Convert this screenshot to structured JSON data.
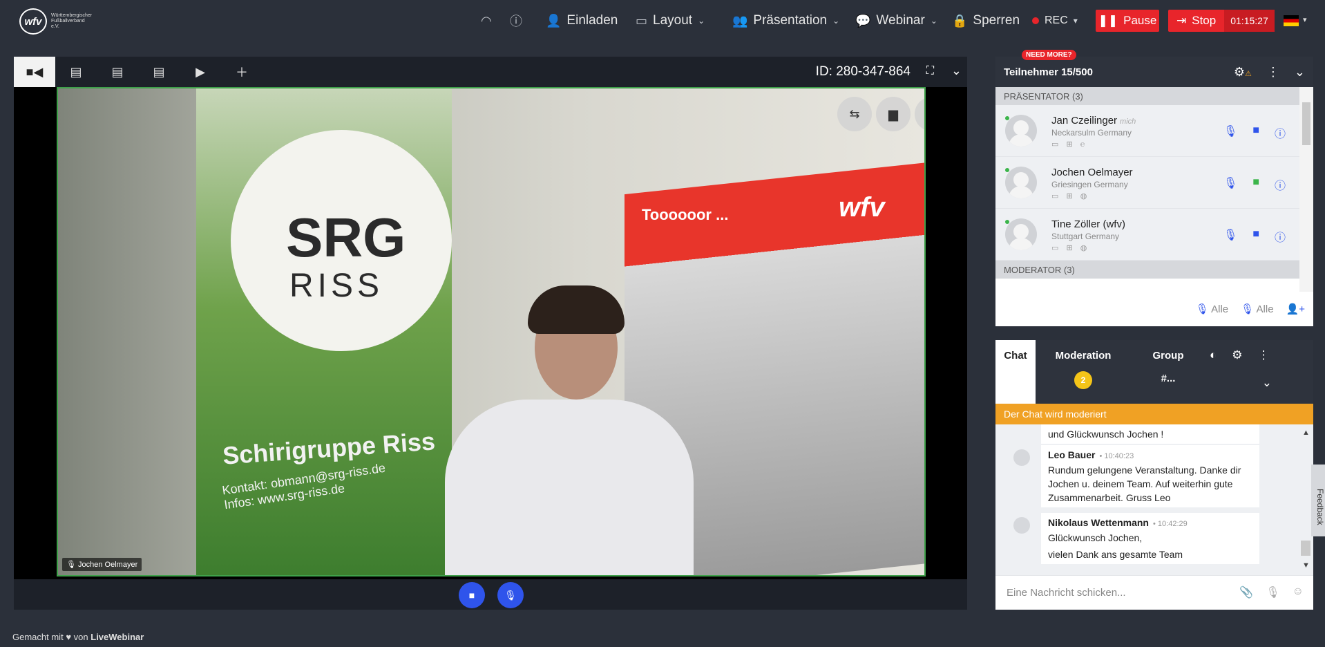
{
  "header": {
    "logo_mark": "wfv",
    "logo_text": "Württembergischer Fußballverband e.V.",
    "invite": "Einladen",
    "layout": "Layout",
    "presentation": "Präsentation",
    "webinar": "Webinar",
    "lock": "Sperren",
    "rec": "REC",
    "pause": "Pause",
    "stop": "Stop",
    "timer": "01:15:27"
  },
  "stage": {
    "meeting_id": "ID: 280-347-864",
    "video_label": "Jochen Oelmayer",
    "scene": {
      "srg": "SRG",
      "riss": "RISS",
      "schiri": "Schirigruppe Riss",
      "contact": "Kontakt: obmann@srg-riss.de",
      "infos": "Infos: www.srg-riss.de",
      "tor": "Toooooor ...",
      "wfv": "wfv"
    }
  },
  "participants": {
    "need_more": "NEED MORE?",
    "title": "Teilnehmer 15/500",
    "presenter_section": "PRÄSENTATOR",
    "presenter_count": "(3)",
    "moderator_section": "MODERATOR",
    "moderator_count": "(3)",
    "people": [
      {
        "name": "Jan Czeilinger",
        "me": "mich",
        "location": "Neckarsulm Germany"
      },
      {
        "name": "Jochen Oelmayer",
        "location": "Griesingen Germany"
      },
      {
        "name": "Tine Zöller (wfv)",
        "location": "Stuttgart Germany"
      }
    ],
    "mute_all": "Alle",
    "unmute_all": "Alle"
  },
  "chat": {
    "tab_chat": "Chat",
    "tab_moderation": "Moderation",
    "moderation_badge": "2",
    "tab_group": "Group",
    "group_sub": "#...",
    "moderated_notice": "Der Chat wird moderiert",
    "messages": [
      {
        "text": "und Glückwunsch Jochen !"
      },
      {
        "author": "Leo Bauer",
        "time": "10:40:23",
        "text": "Rundum gelungene Veranstaltung. Danke dir Jochen u. deinem Team. Auf weiterhin gute Zusammenarbeit. Gruss Leo"
      },
      {
        "author": "Nikolaus Wettenmann",
        "time": "10:42:29",
        "text": "Glückwunsch Jochen,",
        "text2": "vielen Dank ans gesamte Team"
      }
    ],
    "input_placeholder": "Eine Nachricht schicken...",
    "feedback": "Feedback"
  },
  "footer": {
    "made_with": "Gemacht mit",
    "from": "von",
    "brand": "LiveWebinar"
  },
  "colors": {
    "accent_blue": "#2f54eb",
    "stop_red": "#e8252b",
    "moderated_orange": "#f0a124",
    "online_green": "#3bb54a"
  }
}
